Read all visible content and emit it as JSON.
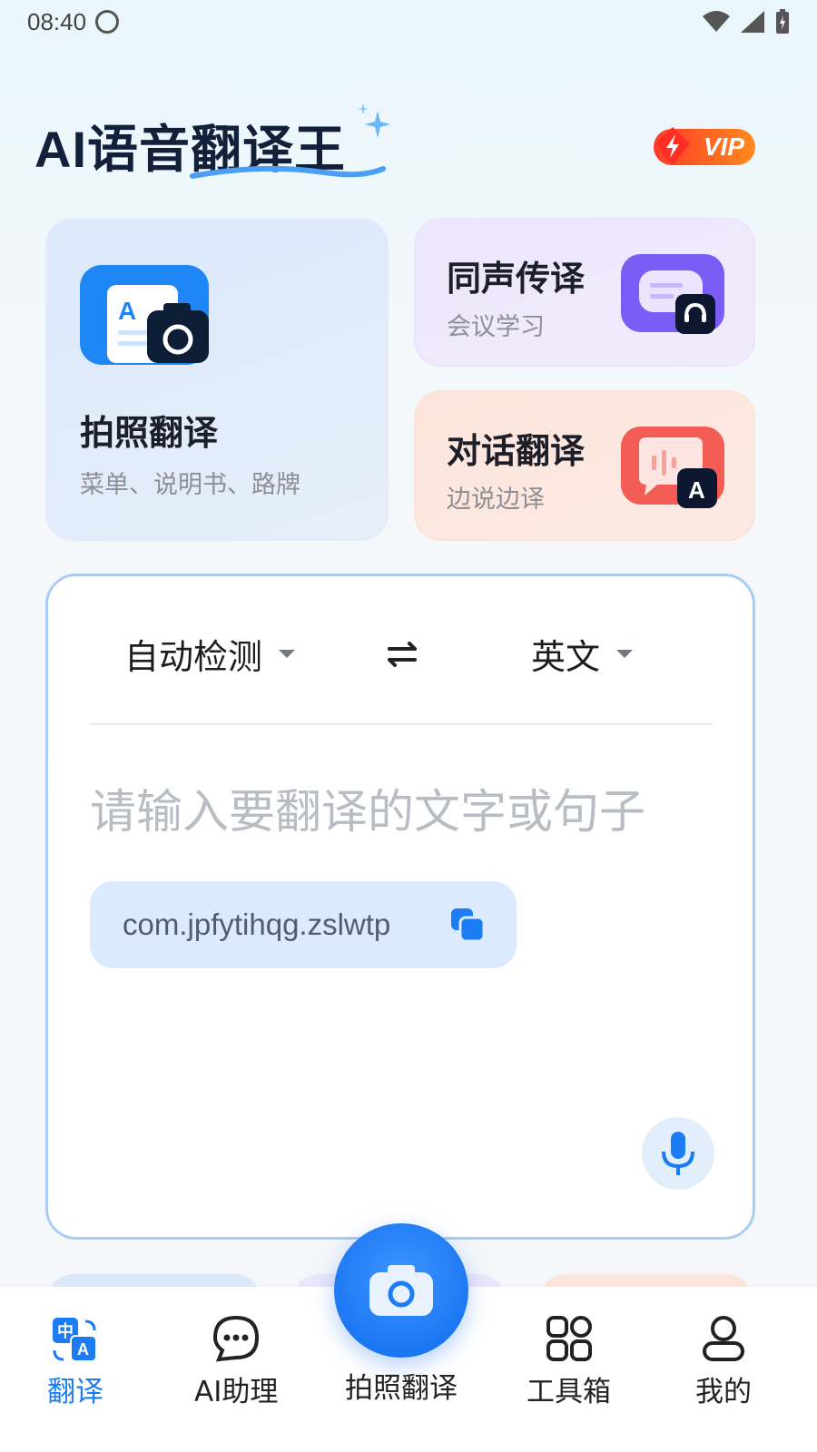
{
  "status_bar": {
    "time": "08:40"
  },
  "header": {
    "app_title": "AI语音翻译王",
    "vip_label": "VIP"
  },
  "cards": {
    "photo": {
      "title": "拍照翻译",
      "subtitle": "菜单、说明书、路牌"
    },
    "simultaneous": {
      "title": "同声传译",
      "subtitle": "会议学习"
    },
    "dialog": {
      "title": "对话翻译",
      "subtitle": "边说边译"
    }
  },
  "translator": {
    "source_lang": "自动检测",
    "target_lang": "英文",
    "input_placeholder": "请输入要翻译的文字或句子",
    "package_text": "com.jpfytihqg.zslwtp"
  },
  "tab_bar": {
    "tabs": [
      {
        "label": "翻译",
        "active": true
      },
      {
        "label": "AI助理"
      },
      {
        "label": "拍照翻译"
      },
      {
        "label": "工具箱"
      },
      {
        "label": "我的"
      }
    ]
  },
  "colors": {
    "accent": "#1b7cf4",
    "vip": "#ff5a22",
    "panel_border": "#a9cdf2"
  }
}
